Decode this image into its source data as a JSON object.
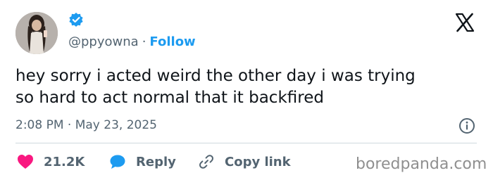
{
  "author": {
    "handle": "@ppyowna",
    "separator": "·",
    "follow_label": "Follow",
    "verified": true
  },
  "tweet": {
    "text": "hey sorry i acted weird the other day i was trying\nso hard to act normal that it backfired",
    "timestamp": "2:08 PM · May 23, 2025"
  },
  "actions": {
    "likes_count": "21.2K",
    "reply_label": "Reply",
    "copy_link_label": "Copy link"
  },
  "watermark": "boredpanda.com",
  "colors": {
    "accent": "#1d9bf0",
    "like": "#f91880",
    "text": "#0f1419",
    "muted": "#536471"
  },
  "icons": [
    "verified-badge-icon",
    "x-logo-icon",
    "info-icon",
    "heart-icon",
    "reply-bubble-icon",
    "link-icon"
  ]
}
